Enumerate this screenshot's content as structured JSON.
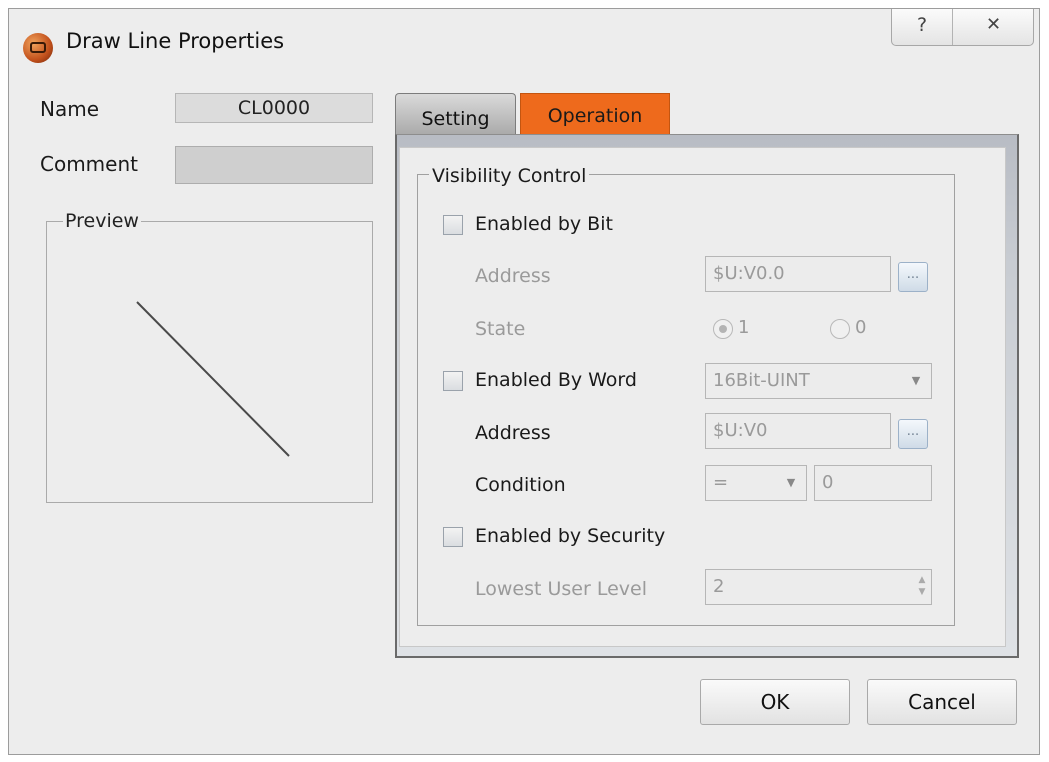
{
  "window": {
    "title": "Draw Line Properties",
    "help_glyph": "?",
    "close_glyph": "✕"
  },
  "left": {
    "name_label": "Name",
    "name_value": "CL0000",
    "comment_label": "Comment",
    "comment_value": "",
    "preview_label": "Preview"
  },
  "tabs": [
    {
      "label": "Setting",
      "active": false
    },
    {
      "label": "Operation",
      "active": true,
      "color": "#ee6a1c"
    }
  ],
  "visibility": {
    "group_label": "Visibility Control",
    "enabled_by_bit": {
      "label": "Enabled by Bit",
      "checked": false,
      "address_label": "Address",
      "address_value": "$U:V0.0",
      "state_label": "State",
      "state_options": [
        "1",
        "0"
      ],
      "state_selected": "1"
    },
    "enabled_by_word": {
      "label": "Enabled By Word",
      "checked": false,
      "type_value": "16Bit-UINT",
      "address_label": "Address",
      "address_value": "$U:V0",
      "condition_label": "Condition",
      "condition_operator": "=",
      "condition_value": "0"
    },
    "enabled_by_security": {
      "label": "Enabled by Security",
      "checked": false,
      "lowest_level_label": "Lowest User Level",
      "lowest_level_value": "2"
    },
    "ellipsis_glyph": "..."
  },
  "buttons": {
    "ok": "OK",
    "cancel": "Cancel"
  },
  "icons": {
    "app": "app-icon",
    "help": "help-icon",
    "close": "close-icon",
    "dropdown": "chevron-down-icon",
    "spinner": "spinner-icon"
  }
}
